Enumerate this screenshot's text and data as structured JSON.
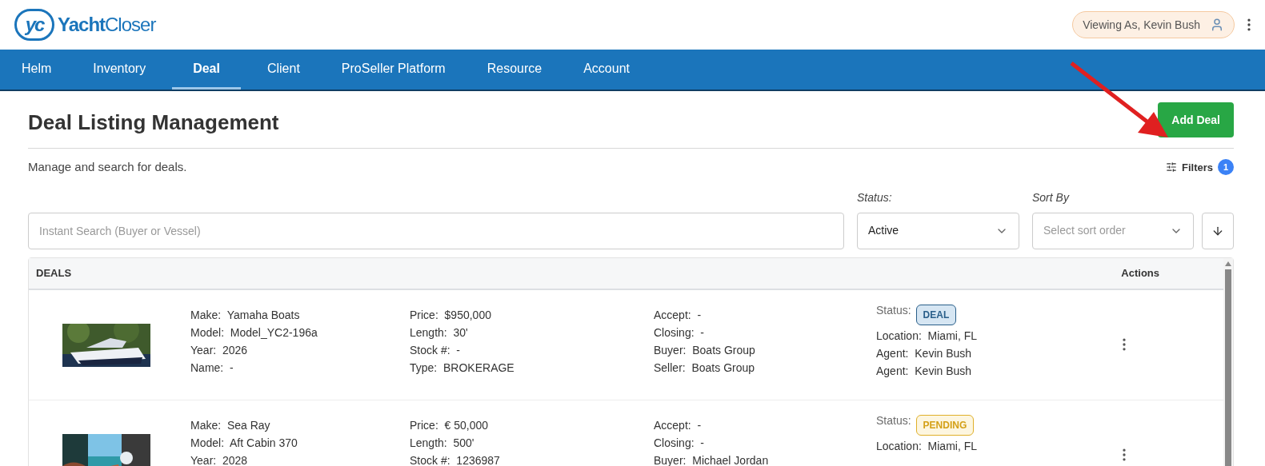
{
  "header": {
    "logo_mark": "yc",
    "logo_bold": "Yacht",
    "logo_light": "Closer",
    "viewing_as": "Viewing As, Kevin Bush"
  },
  "nav": [
    {
      "label": "Helm",
      "selected": false
    },
    {
      "label": "Inventory",
      "selected": false
    },
    {
      "label": "Deal",
      "selected": true
    },
    {
      "label": "Client",
      "selected": false
    },
    {
      "label": "ProSeller Platform",
      "selected": false
    },
    {
      "label": "Resource",
      "selected": false
    },
    {
      "label": "Account",
      "selected": false
    }
  ],
  "page": {
    "title": "Deal Listing Management",
    "subtitle": "Manage and search for deals.",
    "add_button": "Add Deal",
    "filters": {
      "label": "Filters",
      "count": "1"
    }
  },
  "search": {
    "placeholder": "Instant Search (Buyer or Vessel)"
  },
  "status_filter": {
    "label": "Status:",
    "value": "Active"
  },
  "sort": {
    "label": "Sort By",
    "placeholder": "Select sort order"
  },
  "table": {
    "columns": [
      "DEALS",
      "Actions"
    ],
    "rows": [
      {
        "columns": [
          [
            "Make:  Yamaha Boats",
            "Model:  Model_YC2-196a",
            "Year:  2026",
            "Name:  -"
          ],
          [
            "Price:  $950,000",
            "Length:  30'",
            "Stock #:  -",
            "Type:  BROKERAGE"
          ],
          [
            "Accept:  -",
            "Closing:  -",
            "Buyer:  Boats Group",
            "Seller:  Boats Group"
          ]
        ],
        "status": {
          "label": "Status:",
          "badge": "DEAL",
          "kind": "deal"
        },
        "details": [
          "Location:  Miami, FL",
          "Agent:  Kevin Bush",
          "Agent:  Kevin Bush"
        ]
      },
      {
        "columns": [
          [
            "Make:  Sea Ray",
            "Model:  Aft Cabin 370",
            "Year:  2028"
          ],
          [
            "Price:  € 50,000",
            "Length:  500'",
            "Stock #:  1236987"
          ],
          [
            "Accept:  -",
            "Closing:  -",
            "Buyer:  Michael Jordan"
          ]
        ],
        "status": {
          "label": "Status:",
          "badge": "PENDING",
          "kind": "pending"
        },
        "details": [
          "Location:  Miami, FL"
        ]
      }
    ]
  }
}
